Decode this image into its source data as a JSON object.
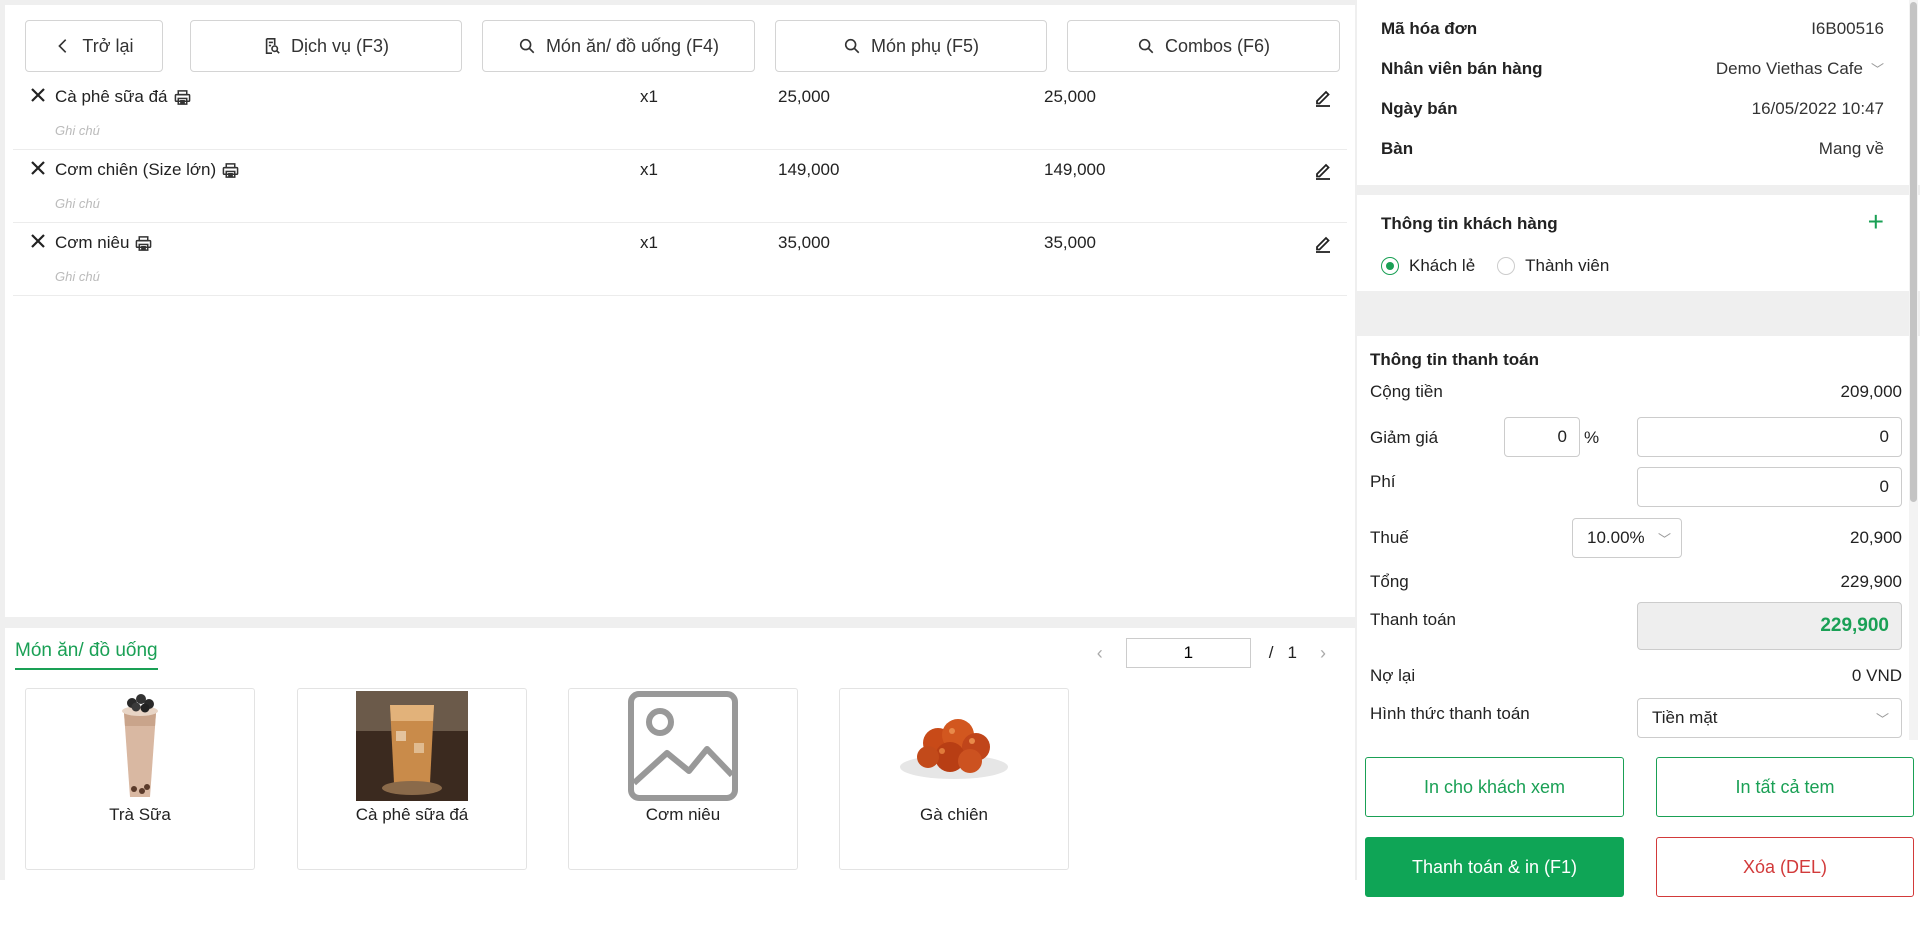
{
  "toolbar": {
    "back": "Trở lại",
    "services": "Dịch vụ (F3)",
    "dishes": "Món ăn/ đồ uống (F4)",
    "sides": "Món phụ (F5)",
    "combos": "Combos (F6)"
  },
  "order_items": [
    {
      "name": "Cà phê sữa đá",
      "note": "Ghi chú",
      "qty": "x1",
      "price": "25,000",
      "total": "25,000"
    },
    {
      "name": "Cơm chiên (Size lớn)",
      "note": "Ghi chú",
      "qty": "x1",
      "price": "149,000",
      "total": "149,000"
    },
    {
      "name": "Cơm niêu",
      "note": "Ghi chú",
      "qty": "x1",
      "price": "35,000",
      "total": "35,000"
    }
  ],
  "catalog": {
    "tab": "Món ăn/ đồ uống",
    "page": "1",
    "slash": "/",
    "total_pages": "1",
    "products": [
      {
        "name": "Trà Sữa"
      },
      {
        "name": "Cà phê sữa đá"
      },
      {
        "name": "Cơm niêu"
      },
      {
        "name": "Gà chiên"
      }
    ]
  },
  "invoice": {
    "code_label": "Mã hóa đơn",
    "code_value": "I6B00516",
    "staff_label": "Nhân viên bán hàng",
    "staff_value": "Demo Viethas Cafe",
    "date_label": "Ngày bán",
    "date_value": "16/05/2022 10:47",
    "table_label": "Bàn",
    "table_value": "Mang về"
  },
  "customer": {
    "title": "Thông tin khách hàng",
    "option_guest": "Khách lẻ",
    "option_member": "Thành viên",
    "selected": "guest"
  },
  "payment": {
    "title": "Thông tin thanh toán",
    "subtotal_label": "Cộng tiền",
    "subtotal": "209,000",
    "discount_label": "Giảm giá",
    "discount_percent": "0",
    "percent_sign": "%",
    "discount_amount": "0",
    "fee_label": "Phí",
    "fee": "0",
    "tax_label": "Thuế",
    "tax_rate": "10.00%",
    "tax_amount": "20,900",
    "total_label": "Tổng",
    "total": "229,900",
    "pay_label": "Thanh toán",
    "pay_amount": "229,900",
    "debt_label": "Nợ lại",
    "debt": "0 VND",
    "method_label": "Hình thức thanh toán",
    "method": "Tiền mặt"
  },
  "actions": {
    "print_preview": "In cho khách xem",
    "print_labels": "In tất cả tem",
    "pay_print": "Thanh toán & in (F1)",
    "delete": "Xóa (DEL)"
  },
  "colors": {
    "accent": "#1aa055",
    "danger": "#d23a3a",
    "background": "#efefef"
  }
}
